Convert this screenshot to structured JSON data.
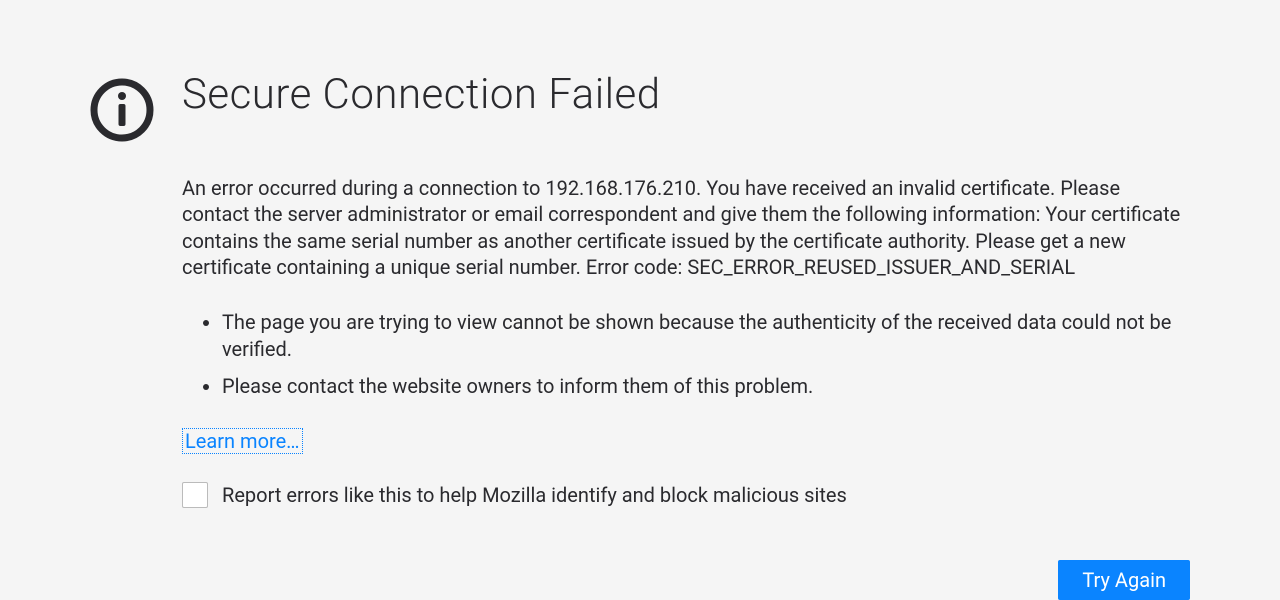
{
  "title": "Secure Connection Failed",
  "description": "An error occurred during a connection to 192.168.176.210. You have received an invalid certificate. Please contact the server administrator or email correspondent and give them the following information: Your certificate contains the same serial number as another certificate issued by the certificate authority. Please get a new certificate containing a unique serial number. Error code: SEC_ERROR_REUSED_ISSUER_AND_SERIAL",
  "bullets": [
    "The page you are trying to view cannot be shown because the authenticity of the received data could not be verified.",
    "Please contact the website owners to inform them of this problem."
  ],
  "learn_more_label": "Learn more…",
  "report_label": "Report errors like this to help Mozilla identify and block malicious sites",
  "try_again_label": "Try Again"
}
